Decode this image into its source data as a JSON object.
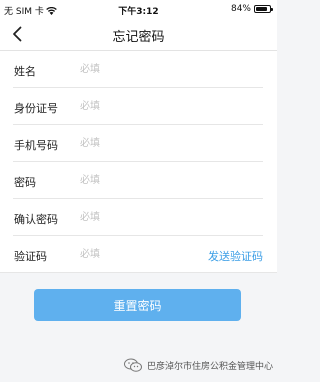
{
  "status_bar": {
    "carrier": "无 SIM 卡",
    "time": "下午3:12",
    "battery": "84%",
    "battery_level": 0.84
  },
  "nav": {
    "title": "忘记密码"
  },
  "form": {
    "rows": [
      {
        "label": "姓名",
        "placeholder": "必填"
      },
      {
        "label": "身份证号",
        "placeholder": "必填"
      },
      {
        "label": "手机号码",
        "placeholder": "必填"
      },
      {
        "label": "密码",
        "placeholder": "必填"
      },
      {
        "label": "确认密码",
        "placeholder": "必填"
      },
      {
        "label": "验证码",
        "placeholder": "必填"
      }
    ],
    "send_code_label": "发送验证码"
  },
  "submit": {
    "label": "重置密码"
  },
  "watermark": {
    "text": "巴彦淖尔市住房公积金管理中心"
  },
  "colors": {
    "accent": "#3b9ee6",
    "button": "#5fb0ee",
    "background": "#f4f5f7"
  }
}
